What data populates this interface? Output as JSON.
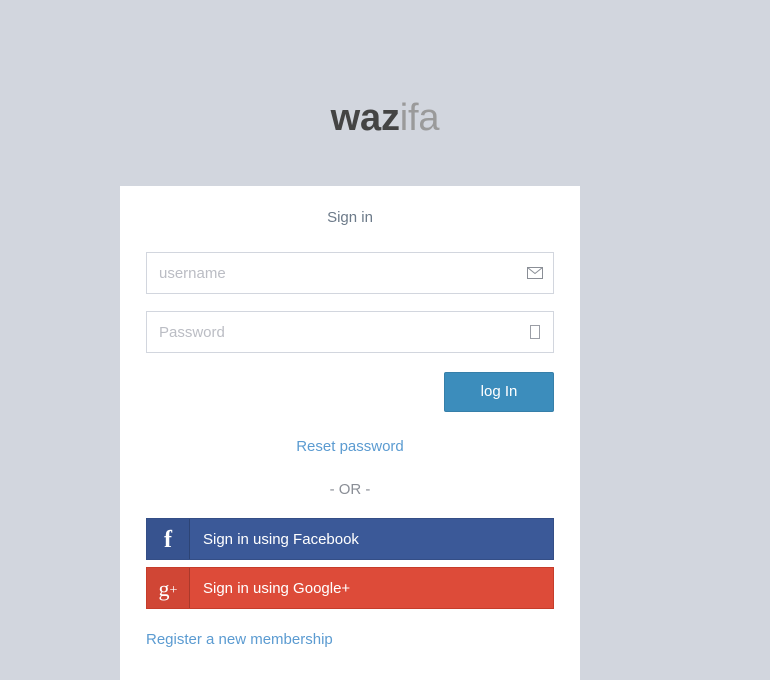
{
  "brand": {
    "name_strong": "waz",
    "name_light": "ifa"
  },
  "card": {
    "message": "Sign in",
    "username_field": {
      "placeholder": "username",
      "value": "",
      "icon": "envelope-icon"
    },
    "password_field": {
      "placeholder": "Password",
      "value": "",
      "icon": "lock-icon-missing-glyph"
    },
    "login_button": "log In",
    "reset_password_link": "Reset password",
    "or_divider": "- OR -",
    "social": [
      {
        "id": "facebook",
        "icon": "f",
        "icon_name": "facebook-icon",
        "label": "Sign in using Facebook",
        "color": "#3b5998"
      },
      {
        "id": "google",
        "icon": "g",
        "icon_suffix": "+",
        "icon_name": "google-plus-icon",
        "label": "Sign in using Google+",
        "color": "#dd4b39"
      }
    ],
    "register_link": "Register a new membership"
  },
  "colors": {
    "page_background": "#d2d6de",
    "card_background": "#ffffff",
    "primary": "#3c8dbc",
    "link": "#5b9bd1",
    "muted_text": "#8a8e96",
    "facebook": "#3b5998",
    "google": "#dd4b39",
    "logo_strong": "#444444",
    "logo_light": "#9a9a9a"
  }
}
